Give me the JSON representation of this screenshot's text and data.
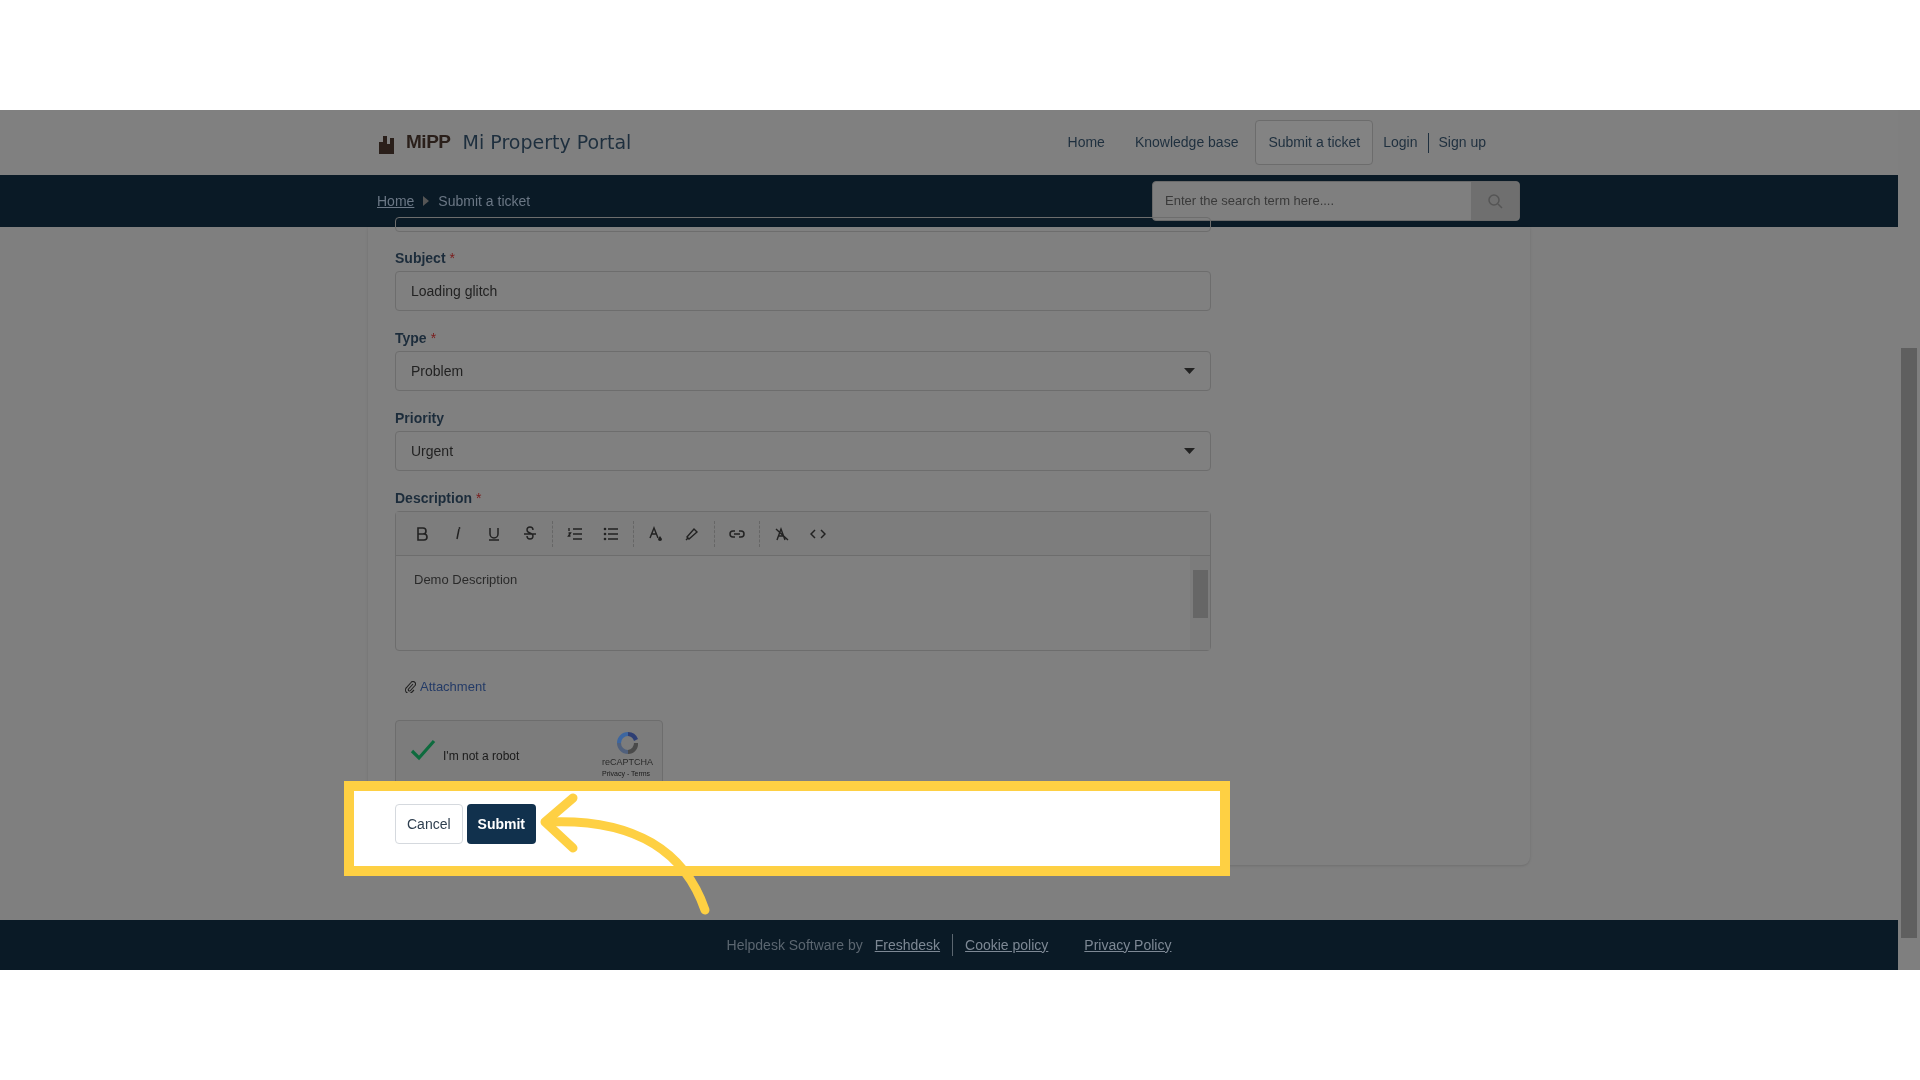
{
  "header": {
    "logo": "MiPP",
    "title": "Mi Property Portal",
    "nav": [
      {
        "label": "Home",
        "selected": false
      },
      {
        "label": "Knowledge base",
        "selected": false
      },
      {
        "label": "Submit a ticket",
        "selected": true
      }
    ],
    "auth": [
      "Login",
      "Sign up"
    ]
  },
  "breadcrumb": [
    {
      "label": "Home",
      "link": true
    },
    {
      "label": "Submit a ticket",
      "link": false
    }
  ],
  "search": {
    "placeholder": "Enter the search term here...."
  },
  "form": {
    "fields": [
      {
        "kind": "text",
        "label": "Subject",
        "required_mark": "*",
        "value": "Loading glitch"
      },
      {
        "kind": "select",
        "label": "Type",
        "required_mark": "*",
        "value": "Problem"
      },
      {
        "kind": "select",
        "label": "Priority",
        "value": "Urgent"
      },
      {
        "kind": "editor",
        "label": "Description",
        "required_mark": "*",
        "value": "Demo Description"
      }
    ],
    "attachment": "Attachment",
    "captcha": {
      "label": "I'm not a robot",
      "checked": true,
      "brand": "reCAPTCHA",
      "links": "Privacy - Terms"
    },
    "buttons": [
      {
        "label": "Cancel",
        "kind": "secondary"
      },
      {
        "label": "Submit",
        "kind": "primary"
      }
    ]
  },
  "footer": {
    "text": "Helpdesk Software by",
    "links": [
      "Freshdesk",
      "Cookie policy",
      "Privacy Policy"
    ]
  },
  "highlight": {
    "kind": "arrow"
  }
}
